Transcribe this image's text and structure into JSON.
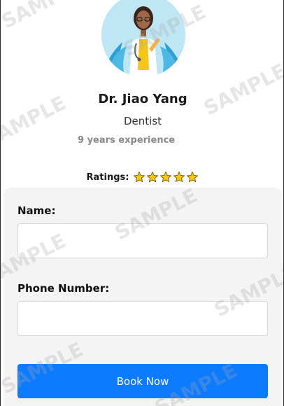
{
  "doctor": {
    "name": "Dr. Jiao Yang",
    "specialty": "Dentist",
    "experience": "9 years experience"
  },
  "ratings": {
    "label": "Ratings:",
    "stars": 5,
    "max": 5,
    "star_color": "#f5c518"
  },
  "form": {
    "name_label": "Name:",
    "name_value": "",
    "phone_label": "Phone Number:",
    "phone_value": "",
    "submit_label": "Book Now"
  },
  "watermark": "SAMPLE",
  "colors": {
    "primary": "#0d7bff",
    "card_bg": "#f4f4f4",
    "muted_text": "#8a8a8a"
  }
}
